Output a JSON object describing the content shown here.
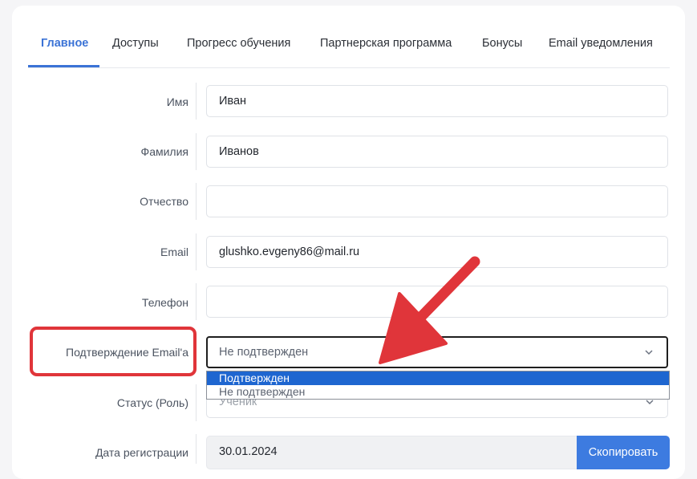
{
  "tabs": [
    {
      "label": "Главное",
      "active": true
    },
    {
      "label": "Доступы"
    },
    {
      "label": "Прогресс обучения"
    },
    {
      "label": "Партнерская программа"
    },
    {
      "label": "Бонусы"
    },
    {
      "label": "Email уведомления"
    }
  ],
  "form": {
    "first_name": {
      "label": "Имя",
      "value": "Иван"
    },
    "last_name": {
      "label": "Фамилия",
      "value": "Иванов"
    },
    "middle_name": {
      "label": "Отчество",
      "value": ""
    },
    "email": {
      "label": "Email",
      "value": "glushko.evgeny86@mail.ru"
    },
    "phone": {
      "label": "Телефон",
      "value": ""
    },
    "email_confirm": {
      "label": "Подтверждение Email'а",
      "value": "Не подтвержден",
      "options": [
        "Подтвержден",
        "Не подтвержден"
      ]
    },
    "status": {
      "label": "Статус (Роль)",
      "value": "Ученик"
    },
    "reg_date": {
      "label": "Дата регистрации",
      "value": "30.01.2024",
      "copy_label": "Скопировать"
    }
  },
  "icons": {
    "chevron": "chevron-down-icon"
  },
  "colors": {
    "accent": "#3b73d6",
    "highlight": "#e0353a",
    "option_selected": "#1e66d0",
    "button": "#3d7be0"
  }
}
